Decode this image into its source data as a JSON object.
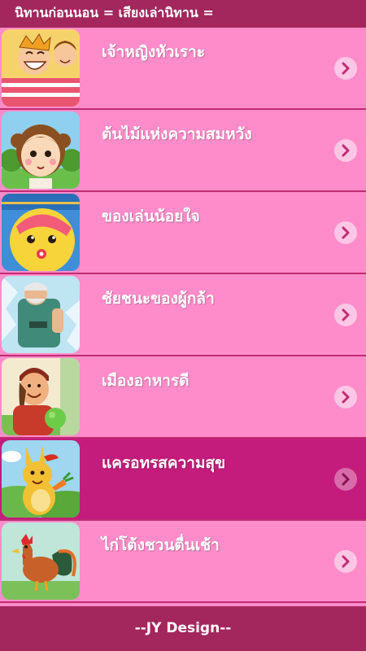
{
  "header": {
    "title": "นิทานก่อนนอน = เสียงเล่านิทาน ="
  },
  "stories": [
    {
      "title": "เจ้าหญิงหัวเราะ",
      "icon": "laughing-princess-thumbnail"
    },
    {
      "title": "ต้นไม้แห่งความสมหวัง",
      "icon": "wishing-tree-girl-thumbnail"
    },
    {
      "title": "ของเล่นน้อยใจ",
      "icon": "sad-toy-ball-thumbnail"
    },
    {
      "title": "ชัยชนะของผู้กล้า",
      "icon": "brave-warrior-thumbnail"
    },
    {
      "title": "เมืองอาหารดี",
      "icon": "food-city-thumbnail"
    },
    {
      "title": "แครอทรสความสุข",
      "icon": "happy-kangaroo-thumbnail",
      "selected": true
    },
    {
      "title": "ไก่โต้งชวนตื่นเช้า",
      "icon": "rooster-thumbnail"
    }
  ],
  "footer": {
    "label": "--JY Design--"
  },
  "colors": {
    "bar": "#a3275c",
    "row": "#ff8cca",
    "row_selected": "#c41c7c",
    "divider": "#c02b72"
  }
}
